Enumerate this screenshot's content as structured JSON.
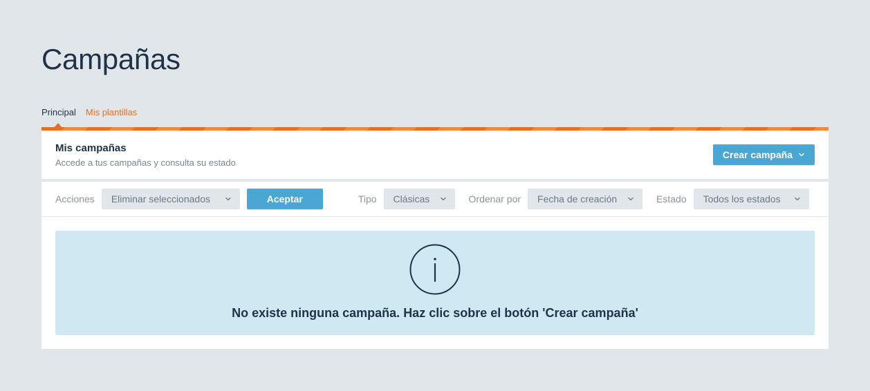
{
  "page": {
    "title": "Campañas"
  },
  "tabs": [
    {
      "label": "Principal",
      "active": true
    },
    {
      "label": "Mis plantillas",
      "active": false
    }
  ],
  "panel": {
    "title": "Mis campañas",
    "subtitle": "Accede a tus campañas y consulta su estado",
    "create_button": "Crear campaña"
  },
  "filters": {
    "actions_label": "Acciones",
    "actions_value": "Eliminar seleccionados",
    "accept_button": "Aceptar",
    "type_label": "Tipo",
    "type_value": "Clásicas",
    "order_label": "Ordenar por",
    "order_value": "Fecha de creación",
    "state_label": "Estado",
    "state_value": "Todos los estados"
  },
  "notice": {
    "message": "No existe ninguna campaña. Haz clic sobre el botón 'Crear campaña'",
    "icon": "info-icon"
  },
  "colors": {
    "accent_orange": "#e8701a",
    "button_blue": "#4aa6d3",
    "notice_bg": "#cfe9f3",
    "page_bg": "#e1e6ea"
  }
}
